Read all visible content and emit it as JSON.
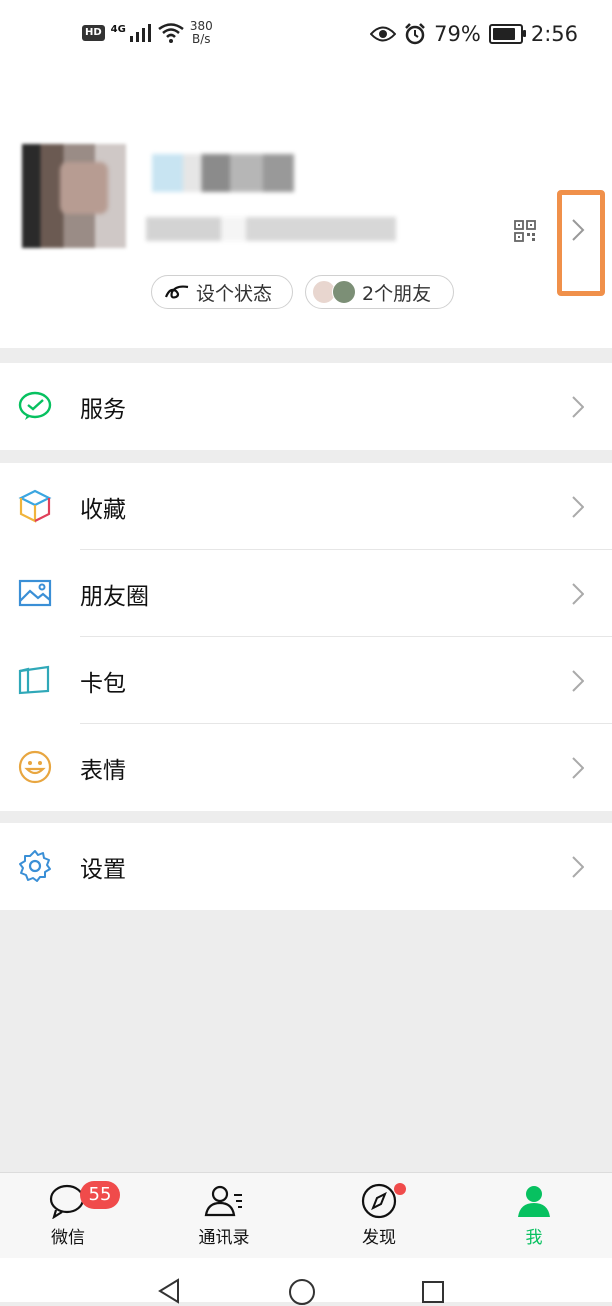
{
  "status_bar": {
    "hd": "HD",
    "network": "4G",
    "speed_value": "380",
    "speed_unit": "B/s",
    "battery": "79%",
    "time": "2:56"
  },
  "profile": {
    "status_pill": "设个状态",
    "friends_pill": "2个朋友"
  },
  "menu": {
    "group1": [
      {
        "label": "服务",
        "icon": "wechat-pay-icon"
      }
    ],
    "group2": [
      {
        "label": "收藏",
        "icon": "favorites-cube-icon"
      },
      {
        "label": "朋友圈",
        "icon": "moments-picture-icon"
      },
      {
        "label": "卡包",
        "icon": "card-wallet-icon"
      },
      {
        "label": "表情",
        "icon": "emoji-smile-icon"
      }
    ],
    "group3": [
      {
        "label": "设置",
        "icon": "settings-gear-icon"
      }
    ]
  },
  "tabbar": {
    "chats": "微信",
    "chats_badge": "55",
    "contacts": "通讯录",
    "discover": "发现",
    "me": "我",
    "active_color": "#07c160"
  },
  "colors": {
    "highlight": "#f0904a",
    "badge": "#f04b4b"
  }
}
